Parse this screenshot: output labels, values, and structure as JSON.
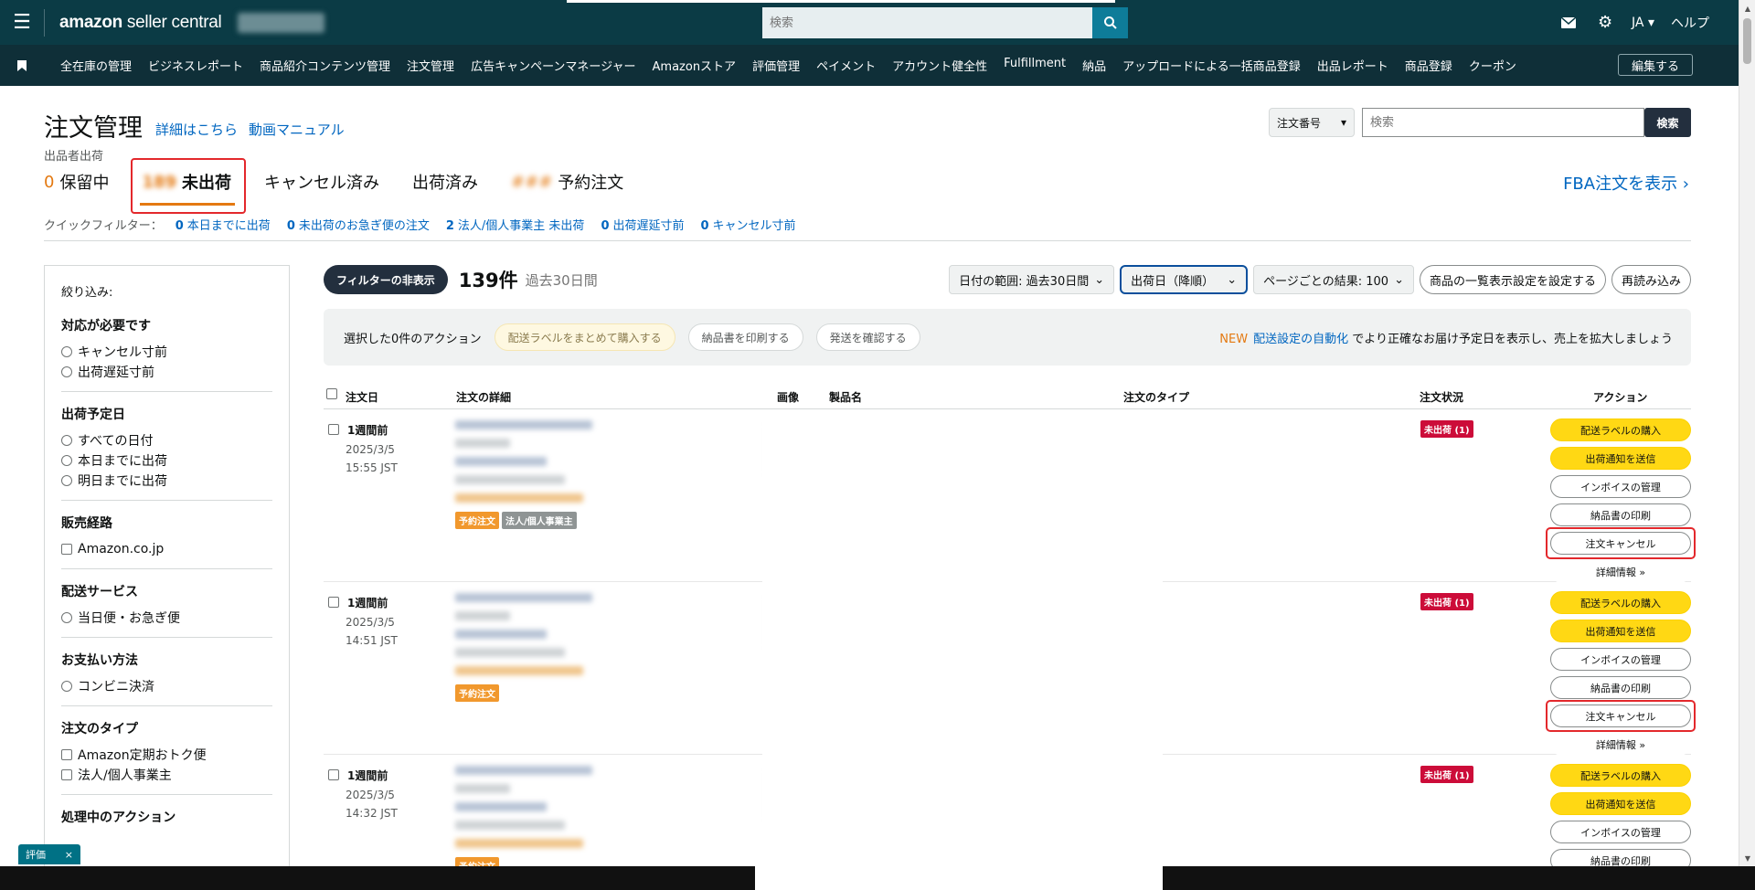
{
  "topbar": {
    "logo_bold": "amazon",
    "logo_rest": " seller central",
    "search_placeholder": "検索",
    "lang": "JA",
    "help": "ヘルプ"
  },
  "nav": {
    "items": [
      "全在庫の管理",
      "ビジネスレポート",
      "商品紹介コンテンツ管理",
      "注文管理",
      "広告キャンペーンマネージャー",
      "Amazonストア",
      "評価管理",
      "ペイメント",
      "アカウント健全性",
      "Fulfillment",
      "納品",
      "アップロードによる一括商品登録",
      "出品レポート",
      "商品登録",
      "クーポン"
    ],
    "edit": "編集する"
  },
  "header": {
    "title": "注文管理",
    "link_details": "詳細はこちら",
    "link_video": "動画マニュアル",
    "seller_fulfilled": "出品者出荷",
    "order_select": "注文番号",
    "search_placeholder": "検索",
    "search_button": "検索",
    "fba_link": "FBA注文を表示 ›"
  },
  "tabs": [
    {
      "count": "0",
      "label": "保留中"
    },
    {
      "count": "189",
      "label": "未出荷"
    },
    {
      "count": "",
      "label": "キャンセル済み"
    },
    {
      "count": "",
      "label": "出荷済み"
    },
    {
      "count": "###",
      "label": "予約注文"
    }
  ],
  "quick_filter": {
    "label": "クイックフィルター：",
    "items": [
      {
        "count": "0",
        "label": "本日までに出荷"
      },
      {
        "count": "0",
        "label": "未出荷のお急ぎ便の注文"
      },
      {
        "count": "2",
        "label": "法人/個人事業主 未出荷"
      },
      {
        "count": "0",
        "label": "出荷遅延寸前"
      },
      {
        "count": "0",
        "label": "キャンセル寸前"
      }
    ]
  },
  "sidebar": {
    "title": "絞り込み:",
    "groups": [
      {
        "title": "対応が必要です",
        "options": [
          "キャンセル寸前",
          "出荷遅延寸前"
        ]
      },
      {
        "title": "出荷予定日",
        "options": [
          "すべての日付",
          "本日までに出荷",
          "明日までに出荷"
        ]
      },
      {
        "title": "販売経路",
        "options": [
          "Amazon.co.jp"
        ]
      },
      {
        "title": "配送サービス",
        "options": [
          "当日便・お急ぎ便"
        ]
      },
      {
        "title": "お支払い方法",
        "options": [
          "コンビニ決済"
        ]
      },
      {
        "title": "注文のタイプ",
        "options": [
          "Amazon定期おトク便",
          "法人/個人事業主"
        ]
      },
      {
        "title": "処理中のアクション",
        "options": []
      }
    ]
  },
  "toolbar": {
    "hide_filter": "フィルターの非表示",
    "count": "139件",
    "period": "過去30日間",
    "date_range": "日付の範囲: 過去30日間",
    "sort": "出荷日（降順）",
    "per_page": "ページごとの結果: 100",
    "display_settings": "商品の一覧表示設定を設定する",
    "reload": "再読み込み"
  },
  "action_bar": {
    "selected": "選択した0件のアクション",
    "buy_labels": "配送ラベルをまとめて購入する",
    "print_slip": "納品書を印刷する",
    "confirm_ship": "発送を確認する",
    "notice_new": "NEW",
    "notice_link": "配送設定の自動化",
    "notice_text": "でより正確なお届け予定日を表示し、売上を拡大しましょう"
  },
  "table": {
    "headers": [
      "注文日",
      "注文の詳細",
      "画像",
      "製品名",
      "注文のタイプ",
      "注文状況",
      "アクション"
    ],
    "rows": [
      {
        "ago": "1週間前",
        "date": "2025/3/5",
        "time": "15:55 JST",
        "badges": [
          "予約注文",
          "法人/個人事業主"
        ],
        "status": "未出荷 (1)"
      },
      {
        "ago": "1週間前",
        "date": "2025/3/5",
        "time": "14:51 JST",
        "badges": [
          "予約注文"
        ],
        "status": "未出荷 (1)"
      },
      {
        "ago": "1週間前",
        "date": "2025/3/5",
        "time": "14:32 JST",
        "badges": [
          "予約注文"
        ],
        "status": "未出荷 (1)"
      }
    ],
    "actions": {
      "buy_label": "配送ラベルの購入",
      "send_notice": "出荷通知を送信",
      "invoice": "インボイスの管理",
      "print_slip": "納品書の印刷",
      "cancel": "注文キャンセル",
      "detail": "詳細情報 »"
    }
  },
  "feedback": {
    "label": "評価",
    "close": "×"
  },
  "colors": {
    "topbar": "#0b3b45",
    "navbar": "#0f2f38",
    "accent_orange": "#e47911",
    "link": "#0066c0",
    "yellow_btn": "#ffd814",
    "status_red": "#cc0c39",
    "highlight": "#e3282c"
  }
}
